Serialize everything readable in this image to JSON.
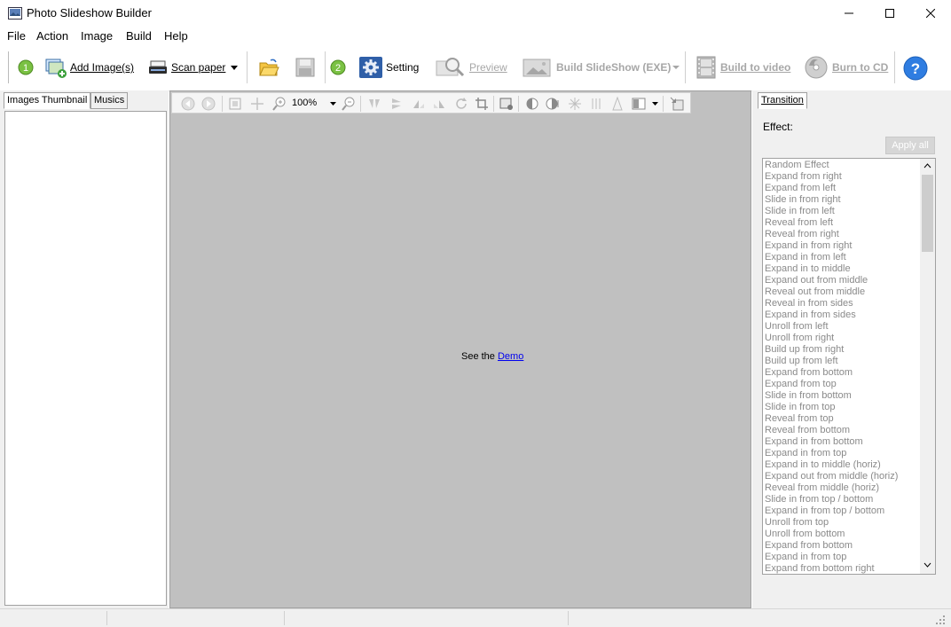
{
  "window": {
    "title": "Photo Slideshow Builder",
    "minimize_label": "—",
    "maximize_label": "☐",
    "close_label": "✕"
  },
  "menu": [
    "File",
    "Action",
    "Image",
    "Build",
    "Help"
  ],
  "toolbar": {
    "step1": "1",
    "add_images": "Add Image(s)",
    "scan_paper": "Scan paper",
    "step2": "2",
    "setting": "Setting",
    "preview": "Preview",
    "build_slideshow": "Build SlideShow (EXE)",
    "build_video": "Build to video",
    "burn_cd": "Burn to CD",
    "help_icon": "?"
  },
  "left_tabs": {
    "thumbnails": "Images Thumbnail",
    "musics": "Musics"
  },
  "image_toolbar": {
    "zoom": "100%"
  },
  "center": {
    "see_the": "See the",
    "demo": "Demo"
  },
  "right_panel": {
    "tab": "Transition",
    "effect_label": "Effect:",
    "apply_all": "Apply all",
    "effects": [
      "Random Effect",
      "Expand from right",
      "Expand from left",
      "Slide in from right",
      "Slide in from left",
      "Reveal from left",
      "Reveal from right",
      "Expand in from right",
      "Expand in from left",
      "Expand in to middle",
      "Expand out from middle",
      "Reveal out from middle",
      "Reveal in from sides",
      "Expand in from sides",
      "Unroll from left",
      "Unroll from right",
      "Build up from right",
      "Build up from left",
      "Expand from bottom",
      "Expand from top",
      "Slide in from bottom",
      "Slide in from top",
      "Reveal from top",
      "Reveal from bottom",
      "Expand in from bottom",
      "Expand in from top",
      "Expand in to middle (horiz)",
      "Expand out from middle (horiz)",
      "Reveal from middle (horiz)",
      "Slide in from top / bottom",
      "Expand in from top / bottom",
      "Unroll from top",
      "Unroll from bottom",
      "Expand from bottom",
      "Expand in from top",
      "Expand from bottom right"
    ]
  },
  "colors": {
    "link": "#0000ee",
    "canvas": "#c0c0c0",
    "panel": "#f0f0f0"
  }
}
